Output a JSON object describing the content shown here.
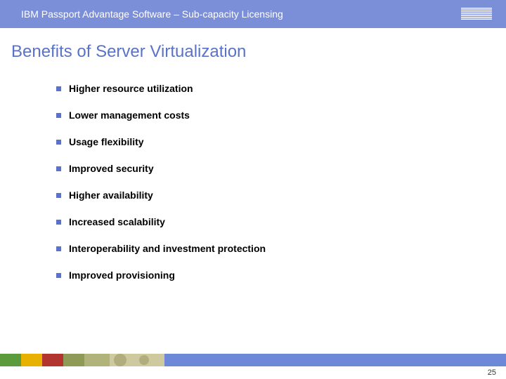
{
  "header": {
    "title": "IBM Passport Advantage Software – Sub-capacity Licensing",
    "logo_label": "IBM"
  },
  "slide": {
    "title": "Benefits of Server Virtualization"
  },
  "bullets": {
    "b0": "Higher resource utilization",
    "b1": "Lower management costs",
    "b2": "Usage flexibility",
    "b3": "Improved security",
    "b4": "Higher availability",
    "b5": "Increased scalability",
    "b6": "Interoperability and investment protection",
    "b7": "Improved provisioning"
  },
  "footer": {
    "page_number": "25",
    "band_colors": {
      "green": "#5b9b3b",
      "yellow": "#e8b100",
      "red": "#b2342e",
      "oliveA": "#8e9a55",
      "oliveB": "#b0b37a",
      "tan": "#cfc9a0",
      "blue": "#6d88d6"
    }
  }
}
